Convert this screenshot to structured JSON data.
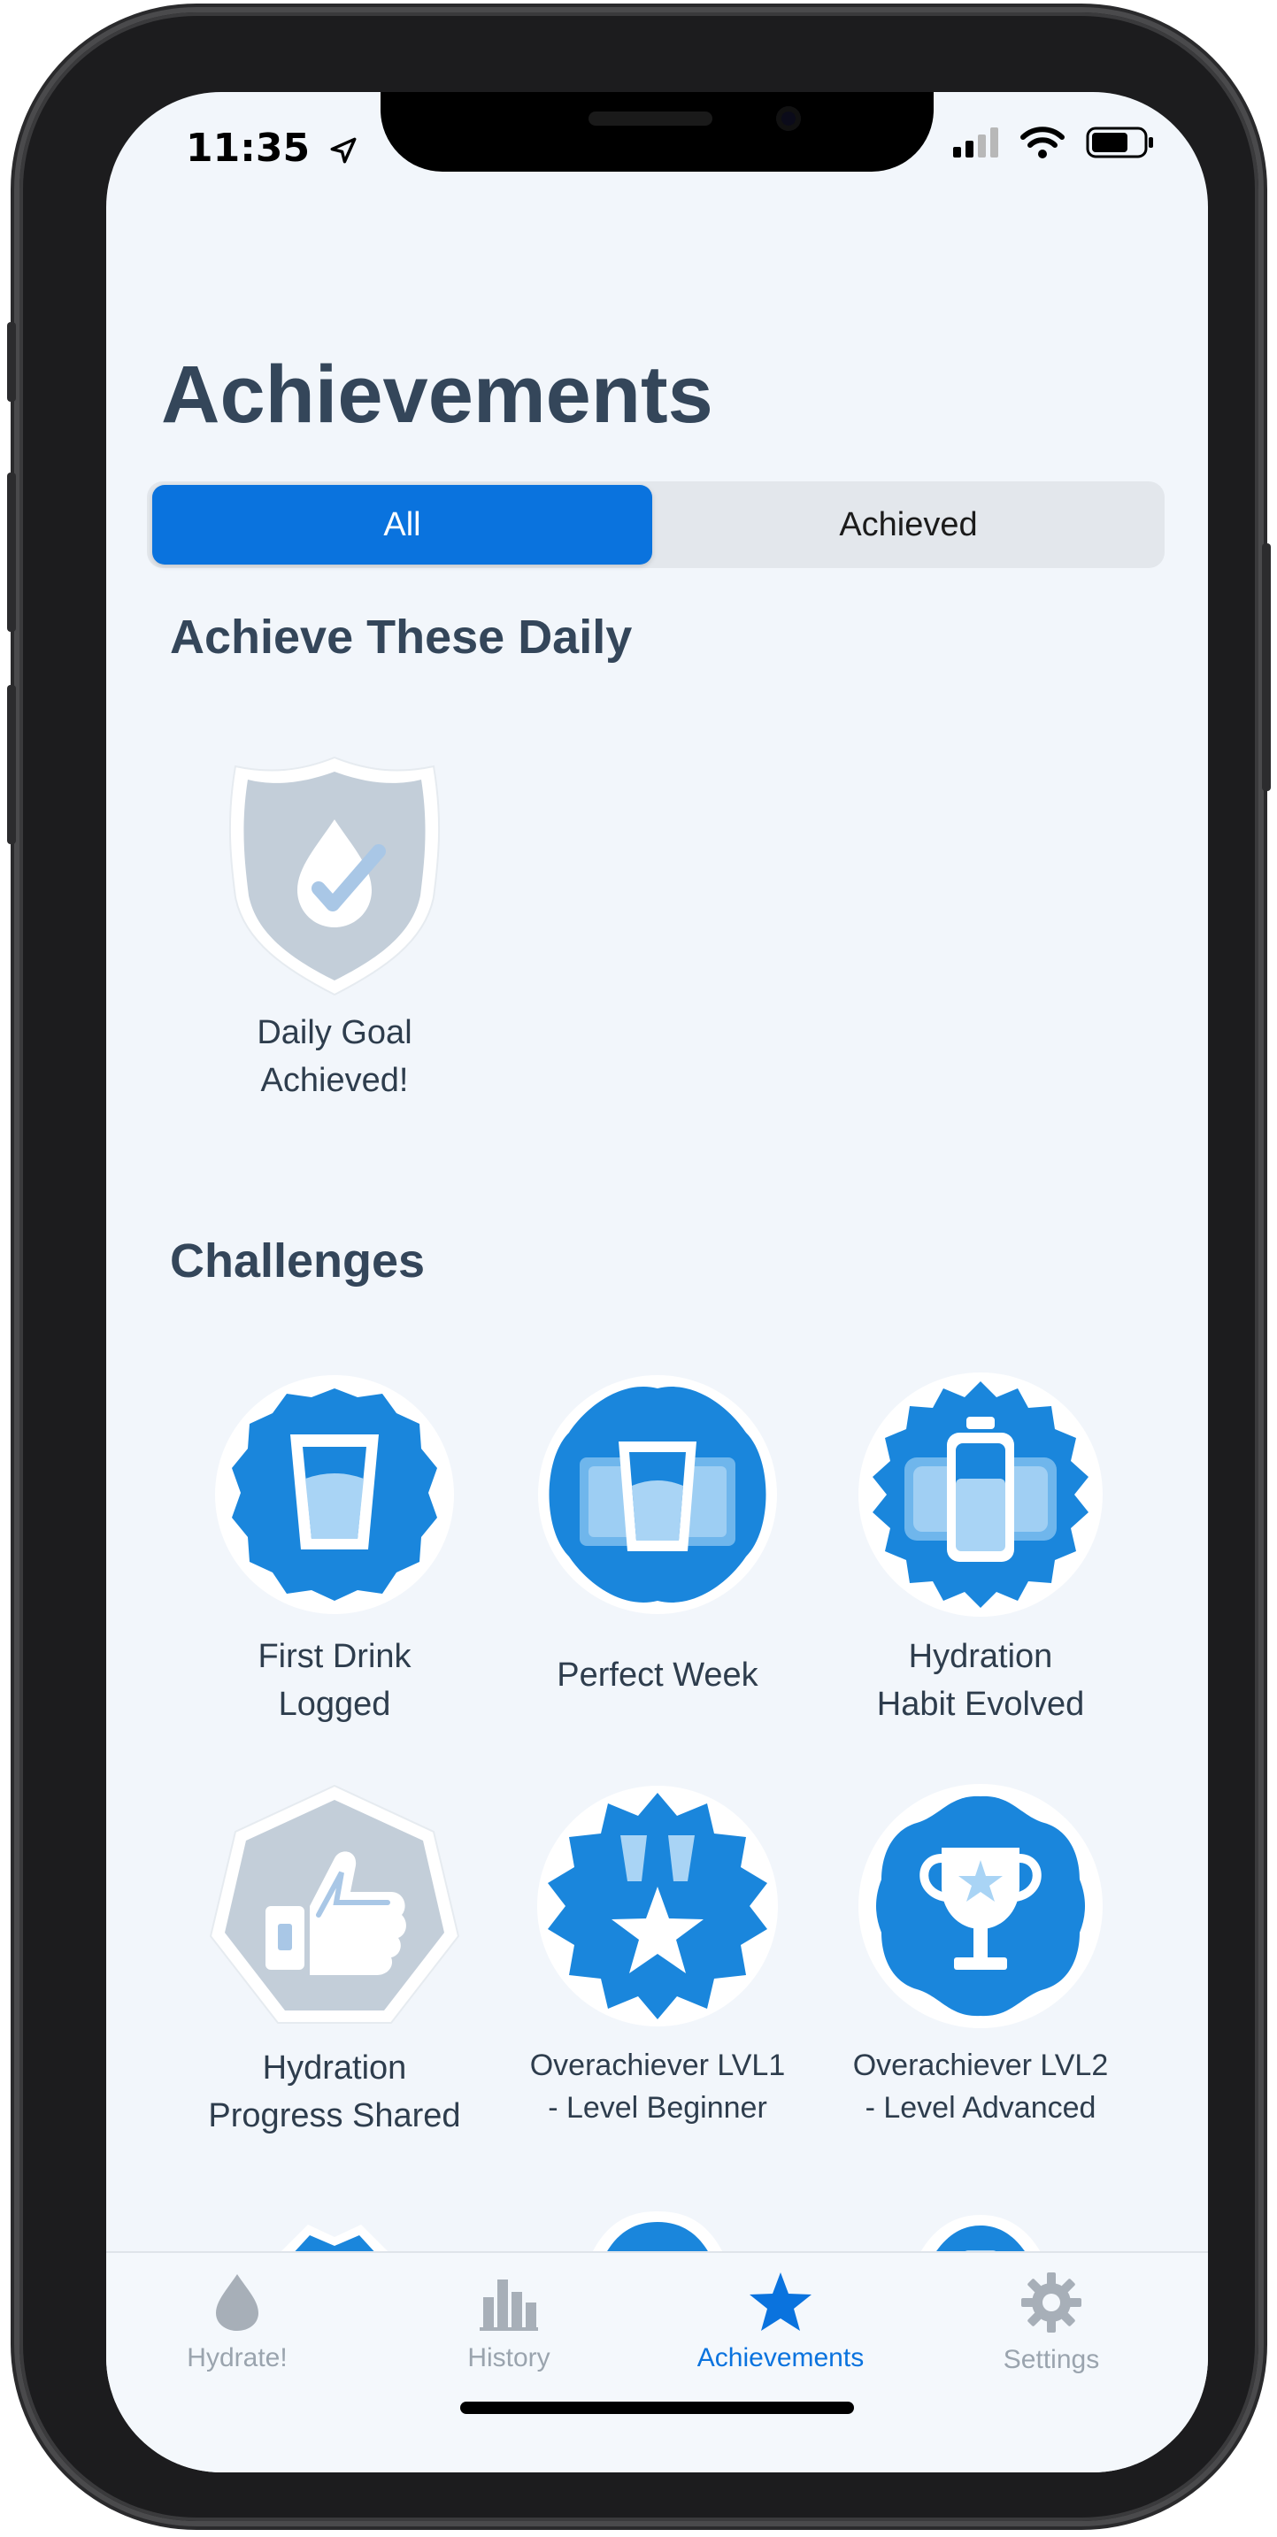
{
  "status": {
    "time": "11:35"
  },
  "header": {
    "title": "Achievements"
  },
  "segments": {
    "all": "All",
    "achieved": "Achieved"
  },
  "daily": {
    "title": "Achieve These Daily",
    "items": [
      {
        "line1": "Daily Goal",
        "line2": "Achieved!",
        "icon": "water-drop-check-shield-icon",
        "achieved": false
      }
    ]
  },
  "challenges": {
    "title": "Challenges",
    "items": [
      {
        "line1": "First Drink",
        "line2": "Logged",
        "icon": "water-glass-icon",
        "achieved": true
      },
      {
        "line1": "Perfect Week",
        "line2": "",
        "icon": "glasses-icon",
        "achieved": true
      },
      {
        "line1": "Hydration",
        "line2": "Habit Evolved",
        "icon": "bottles-icon",
        "achieved": true
      },
      {
        "line1": "Hydration",
        "line2": "Progress Shared",
        "icon": "thumbs-up-icon",
        "achieved": false
      },
      {
        "line1": "Overachiever LVL1",
        "line2": "- Level Beginner",
        "icon": "star-medal-icon",
        "achieved": true
      },
      {
        "line1": "Overachiever LVL2",
        "line2": "- Level Advanced",
        "icon": "trophy-icon",
        "achieved": true
      }
    ]
  },
  "tabs": [
    {
      "label": "Hydrate!",
      "icon": "drop-icon",
      "active": false
    },
    {
      "label": "History",
      "icon": "bar-chart-icon",
      "active": false
    },
    {
      "label": "Achievements",
      "icon": "star-icon",
      "active": true
    },
    {
      "label": "Settings",
      "icon": "gear-icon",
      "active": false
    }
  ],
  "colors": {
    "accent": "#0a73de",
    "badge_blue": "#1a86dc",
    "badge_gray": "#c3ced9",
    "title": "#34465a"
  }
}
